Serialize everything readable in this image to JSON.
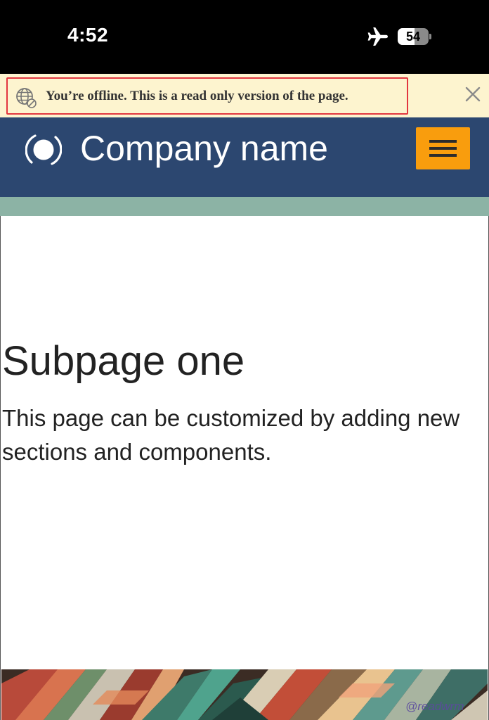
{
  "status_bar": {
    "time": "4:52",
    "battery_level": "54",
    "battery_fraction": 0.54,
    "icons": [
      "airplane-icon",
      "battery-icon"
    ]
  },
  "offline_banner": {
    "message": "You’re offline. This is a read only version of the page.",
    "icon": "globe-offline-icon",
    "close_icon": "close-icon",
    "border_color": "#e2363f",
    "background": "#fdf4cf"
  },
  "header": {
    "company_name": "Company name",
    "logo_icon": "circle-logo-icon",
    "menu_icon": "hamburger-menu-icon",
    "background": "#2c4770",
    "menu_button_color": "#f99d0d",
    "accent_strip_color": "#8cb3a5"
  },
  "main": {
    "title": "Subpage one",
    "description": "This page can be customized by adding new sections and components."
  },
  "footer_image": {
    "watermark": "@readwrm"
  }
}
